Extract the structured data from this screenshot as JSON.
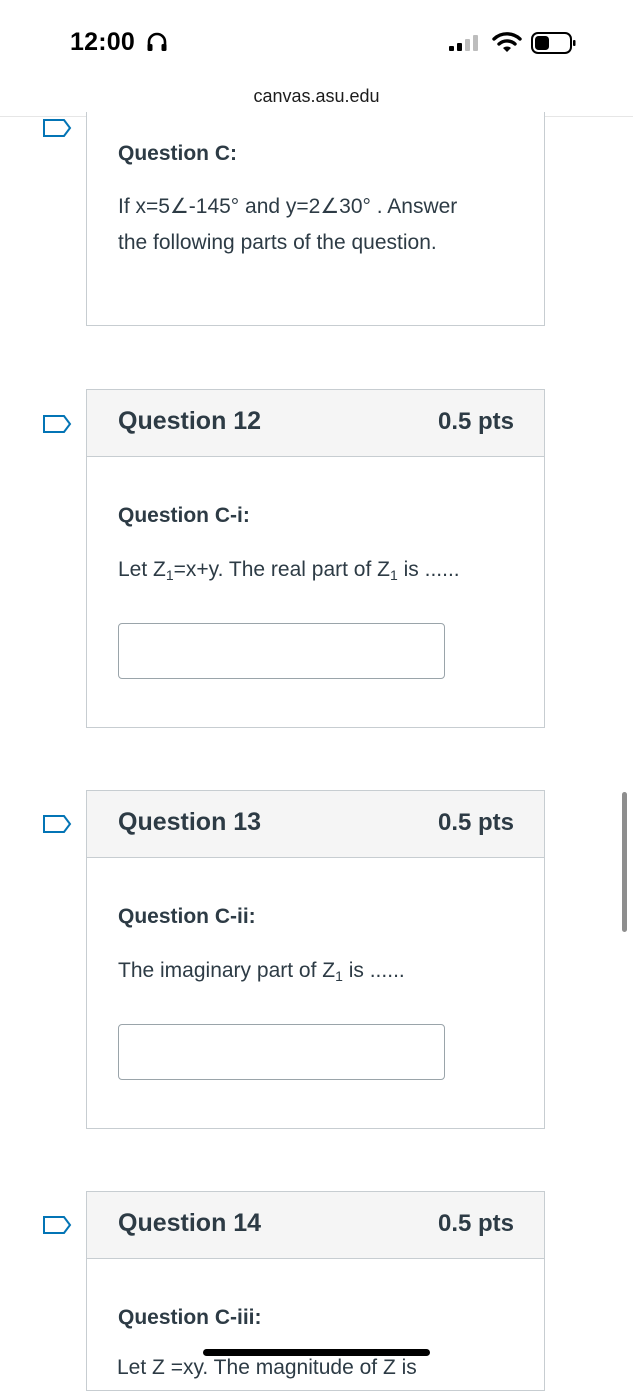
{
  "status_bar": {
    "time": "12:00",
    "icons": [
      "headphones-icon",
      "signal-icon",
      "wifi-icon",
      "battery-icon"
    ]
  },
  "browser": {
    "url": "canvas.asu.edu"
  },
  "stem": {
    "label": "Question C:",
    "text_1": "If x=5∠-145° and y=2∠30° . Answer",
    "text_2": "the following parts of the question."
  },
  "questions": [
    {
      "title": "Question 12",
      "points": "0.5 pts",
      "label": "Question C-i:",
      "text_before": "Let Z",
      "sub": "1",
      "text_mid": "=x+y. The real part of Z",
      "sub2": "1",
      "text_after": " is ......",
      "answer_value": ""
    },
    {
      "title": "Question 13",
      "points": "0.5 pts",
      "label": "Question C-ii:",
      "text_before": "The imaginary part of Z",
      "sub": "1",
      "text_after": " is ......",
      "answer_value": ""
    },
    {
      "title": "Question 14",
      "points": "0.5 pts",
      "label": "Question C-iii:",
      "partial_text": "Let Z  =xy. The magnitude of Z  is"
    }
  ],
  "colors": {
    "text": "#2d3b45",
    "border": "#c7cdd1",
    "header_bg": "#f5f5f5",
    "flag": "#0374b5"
  }
}
